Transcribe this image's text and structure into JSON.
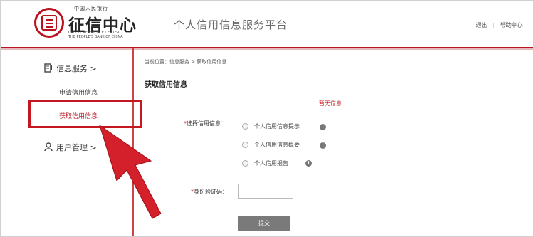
{
  "header": {
    "logo_top": "—中国人民银行—",
    "logo_main": "征信中心",
    "logo_en_1": "CREDIT REFERENCE CENTER",
    "logo_en_2": "THE PEOPLE'S BANK OF CHINA",
    "platform_title": "个人信用信息服务平台",
    "logout_label": "退出",
    "help_label": "帮助中心",
    "separator": "|"
  },
  "sidebar": {
    "group_info": "信息服务 >",
    "item_apply": "申请信用信息",
    "item_get": "获取信用信息",
    "group_user": "用户管理 >"
  },
  "main": {
    "breadcrumb": "当前位置：信息服务 > 获取信用信息",
    "section_title": "获取信用信息",
    "no_info": "暂无信息",
    "select_label_req": "*",
    "select_label": "选择信用信息：",
    "options": [
      "个人信用信息提示",
      "个人信用信息概要",
      "个人信用报告"
    ],
    "info_icon": "i",
    "id_code_label_req": "*",
    "id_code_label": "身份验证码：",
    "id_code_value": "",
    "submit_label": "提交"
  },
  "colors": {
    "brand_red": "#b8131e",
    "highlight_red": "#c4171f",
    "button_gray": "#7a7a7a"
  }
}
